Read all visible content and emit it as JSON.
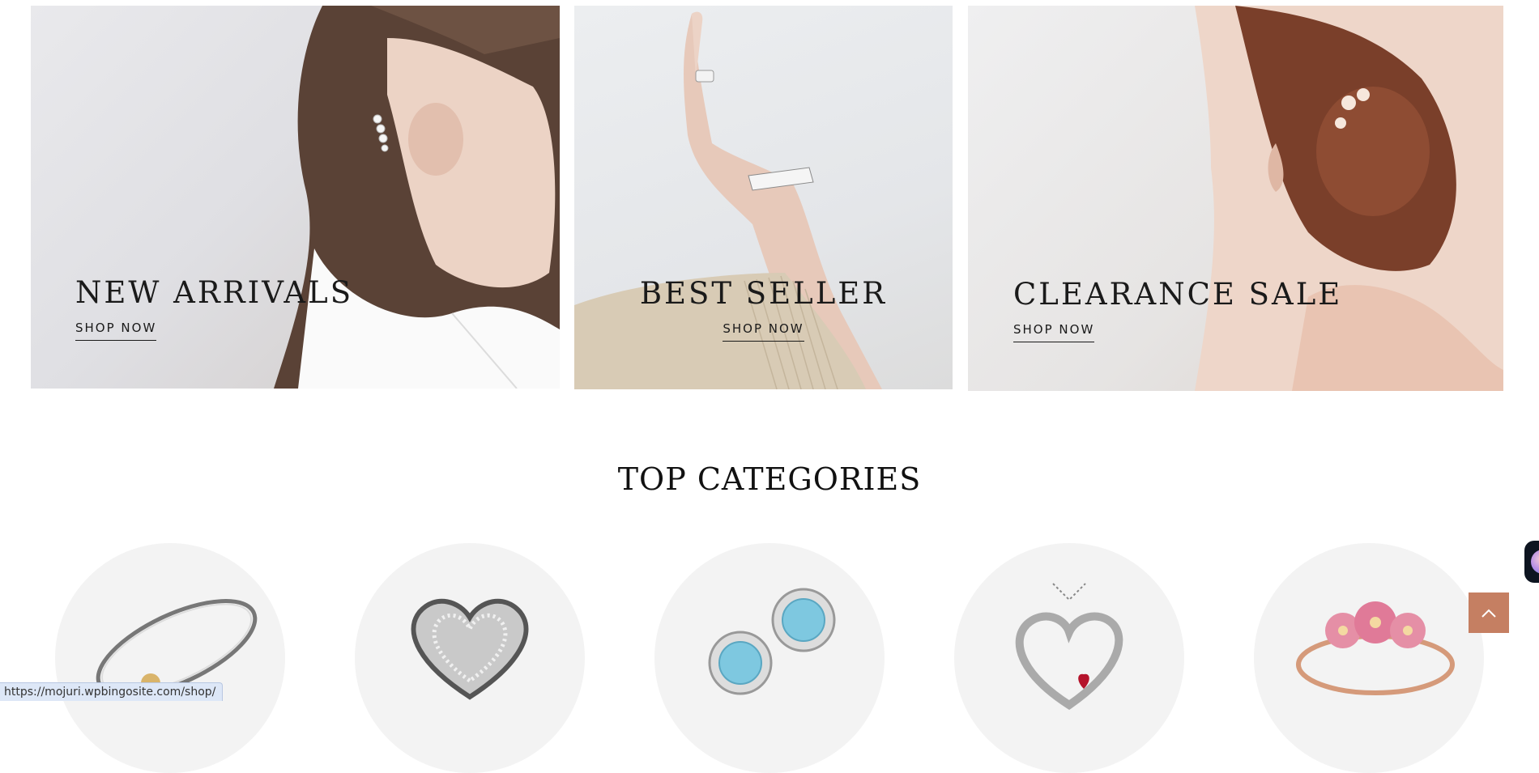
{
  "banners": [
    {
      "title": "NEW ARRIVALS",
      "cta": "SHOP NOW"
    },
    {
      "title": "BEST SELLER",
      "cta": "SHOP NOW"
    },
    {
      "title": "CLEARANCE SALE",
      "cta": "SHOP NOW"
    }
  ],
  "categories_section": {
    "title": "TOP CATEGORIES",
    "items": [
      {
        "icon": "bangle-bracelet-icon"
      },
      {
        "icon": "heart-charm-icon"
      },
      {
        "icon": "blue-stud-earrings-icon"
      },
      {
        "icon": "heart-pendant-necklace-icon"
      },
      {
        "icon": "flower-ring-icon"
      }
    ]
  },
  "widgets": {
    "chat_icon": "chat-avatar-icon",
    "scroll_top_icon": "chevron-up-icon"
  },
  "status_bar": {
    "url": "https://mojuri.wpbingosite.com/shop/"
  },
  "colors": {
    "accent": "#c57f62",
    "chat_bg": "#0d1420",
    "circle_bg": "#f3f3f3"
  }
}
